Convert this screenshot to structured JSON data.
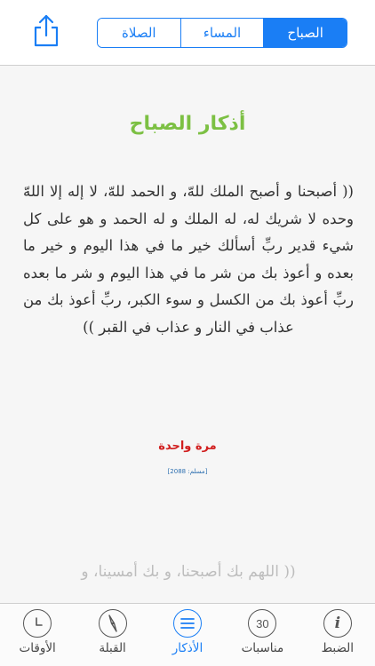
{
  "header": {
    "segments": [
      {
        "label": "الصباح",
        "active": true
      },
      {
        "label": "المساء",
        "active": false
      },
      {
        "label": "الصلاة",
        "active": false
      }
    ],
    "share_icon": "share-icon"
  },
  "content": {
    "title": "أذكار الصباح",
    "zikr_text": "(( أصبحنا و أصبح الملك للهّ، و الحمد للهّ، لا إله إلا اللهّ وحده لا شريك له، له الملك و له الحمد و هو على كل شيء قدير ربِّ أسألك خير ما في هذا اليوم و خير ما بعده و أعوذ بك من شر ما في هذا اليوم و شر ما بعده ربِّ أعوذ بك من الكسل و سوء الكبر، ربِّ أعوذ بك من عذاب في النار و عذاب في القبر ))",
    "count": "مرة واحدة",
    "reference": "[مسلم: 2088]",
    "next_zikr_preview": "(( اللهم بك أصبحنا، و بك أمسينا، و"
  },
  "tabbar": {
    "items": [
      {
        "label": "الضبط",
        "icon": "info-icon",
        "glyph": "i",
        "active": false
      },
      {
        "label": "مناسبات",
        "icon": "calendar-30-icon",
        "glyph": "30",
        "active": false
      },
      {
        "label": "الأذكار",
        "icon": "list-icon",
        "glyph": "",
        "active": true
      },
      {
        "label": "القبلة",
        "icon": "compass-icon",
        "glyph": "",
        "active": false
      },
      {
        "label": "الأوقات",
        "icon": "clock-icon",
        "glyph": "",
        "active": false
      }
    ]
  },
  "colors": {
    "accent": "#1a7ef5",
    "title_green": "#7cc043",
    "count_red": "#d11f1f"
  }
}
